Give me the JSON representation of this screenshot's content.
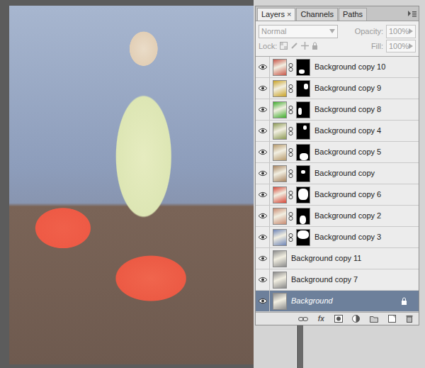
{
  "panel": {
    "tabs": [
      {
        "label": "Layers",
        "close": "×",
        "selected": true
      },
      {
        "label": "Channels",
        "close": "",
        "selected": false
      },
      {
        "label": "Paths",
        "close": "",
        "selected": false
      }
    ],
    "blend_mode": {
      "value": "Normal",
      "disabled": true
    },
    "opacity": {
      "label": "Opacity:",
      "value": "100%",
      "disabled": true
    },
    "lock": {
      "label": "Lock:"
    },
    "fill": {
      "label": "Fill:",
      "value": "100%",
      "disabled": true
    },
    "layers": [
      {
        "name": "Background copy 10",
        "visible": true,
        "kind": "masked",
        "color": "#c8574a",
        "locked": false,
        "selected": false
      },
      {
        "name": "Background copy 9",
        "visible": true,
        "kind": "masked",
        "color": "#c9a227",
        "locked": false,
        "selected": false
      },
      {
        "name": "Background copy 8",
        "visible": true,
        "kind": "masked",
        "color": "#3fae2e",
        "locked": false,
        "selected": false
      },
      {
        "name": "Background copy 4",
        "visible": true,
        "kind": "masked",
        "color": "#8c9a55",
        "locked": false,
        "selected": false
      },
      {
        "name": "Background copy 5",
        "visible": true,
        "kind": "masked",
        "color": "#b79a6c",
        "locked": false,
        "selected": false
      },
      {
        "name": "Background copy",
        "visible": true,
        "kind": "masked",
        "color": "#a88460",
        "locked": false,
        "selected": false
      },
      {
        "name": "Background copy 6",
        "visible": true,
        "kind": "masked",
        "color": "#d8483a",
        "locked": false,
        "selected": false
      },
      {
        "name": "Background copy 2",
        "visible": true,
        "kind": "masked",
        "color": "#c98c73",
        "locked": false,
        "selected": false
      },
      {
        "name": "Background copy 3",
        "visible": true,
        "kind": "masked",
        "color": "#6f86b8",
        "locked": false,
        "selected": false
      },
      {
        "name": "Background copy 11",
        "visible": true,
        "kind": "plain",
        "color": "#8d8d8d",
        "locked": false,
        "selected": false
      },
      {
        "name": "Background copy 7",
        "visible": true,
        "kind": "plain",
        "color": "#8a8a8a",
        "locked": false,
        "selected": false
      },
      {
        "name": "Background",
        "visible": true,
        "kind": "plain",
        "color": "#8f8f8f",
        "locked": true,
        "selected": true
      }
    ],
    "footer": {
      "fx": "fx"
    }
  }
}
